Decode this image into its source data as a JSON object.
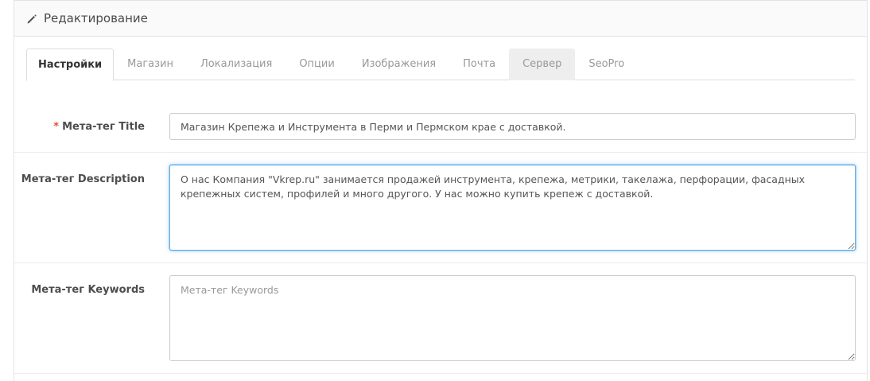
{
  "panel": {
    "title": "Редактирование",
    "icon": "pencil-icon"
  },
  "tabs": [
    {
      "label": "Настройки",
      "state": "active"
    },
    {
      "label": "Магазин",
      "state": "normal"
    },
    {
      "label": "Локализация",
      "state": "normal"
    },
    {
      "label": "Опции",
      "state": "normal"
    },
    {
      "label": "Изображения",
      "state": "normal"
    },
    {
      "label": "Почта",
      "state": "normal"
    },
    {
      "label": "Сервер",
      "state": "hover"
    },
    {
      "label": "SeoPro",
      "state": "normal"
    }
  ],
  "fields": {
    "meta_title": {
      "required_mark": "*",
      "label": "Мета-тег Title",
      "value": "Магазин Крепежа и Инструмента в Перми и Пермском крае с доставкой."
    },
    "meta_description": {
      "label": "Мета-тег Description",
      "value": "О нас Компания \"Vkrep.ru\" занимается продажей инструмента, крепежа, метрики, такелажа, перфорации, фасадных крепежных систем, профилей и много другого. У нас можно купить крепеж с доставкой."
    },
    "meta_keywords": {
      "label": "Мета-тег Keywords",
      "value": "",
      "placeholder": "Мета-тег Keywords"
    }
  },
  "colors": {
    "required": "#e3503e",
    "focus": "#66afe9"
  }
}
